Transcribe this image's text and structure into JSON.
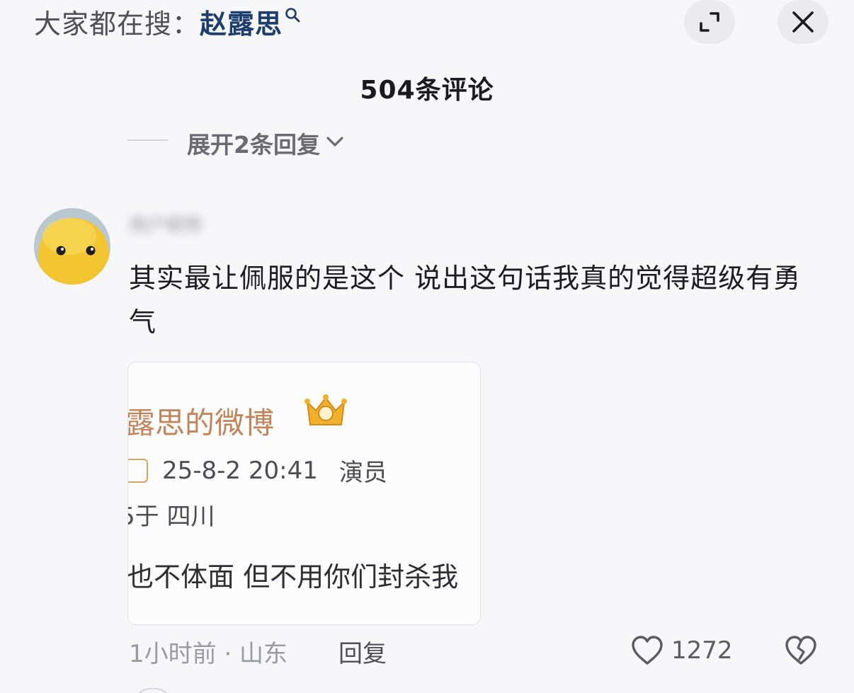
{
  "top_bar": {
    "search_prefix": "大家都在搜：",
    "search_keyword": "赵露思",
    "search_icon": "magnifier-icon",
    "expand_icon": "collapse-corners-icon",
    "close_icon": "close-icon"
  },
  "header": {
    "comment_count": "504条评论"
  },
  "prev_thread": {
    "expand_replies_label": "展开2条回复",
    "chevron_icon": "chevron-down-icon"
  },
  "comment": {
    "username": "用户昵称",
    "text": "其实最让佩服的是这个 说出这句话我真的觉得超级有勇气",
    "image": {
      "title": "露思的微博",
      "timestamp": "25-8-2 20:41",
      "role": "演员",
      "location": "5于 四川",
      "body": "也不体面 但不用你们封杀我"
    },
    "time_location": "1小时前 · 山东",
    "reply_label": "回复",
    "like_count": "1272",
    "like_icon": "heart-icon",
    "dislike_icon": "broken-heart-icon"
  },
  "colors": {
    "background": "#f7f6f9",
    "keyword": "#1e3f6e",
    "weibo_title": "#c1845a"
  }
}
